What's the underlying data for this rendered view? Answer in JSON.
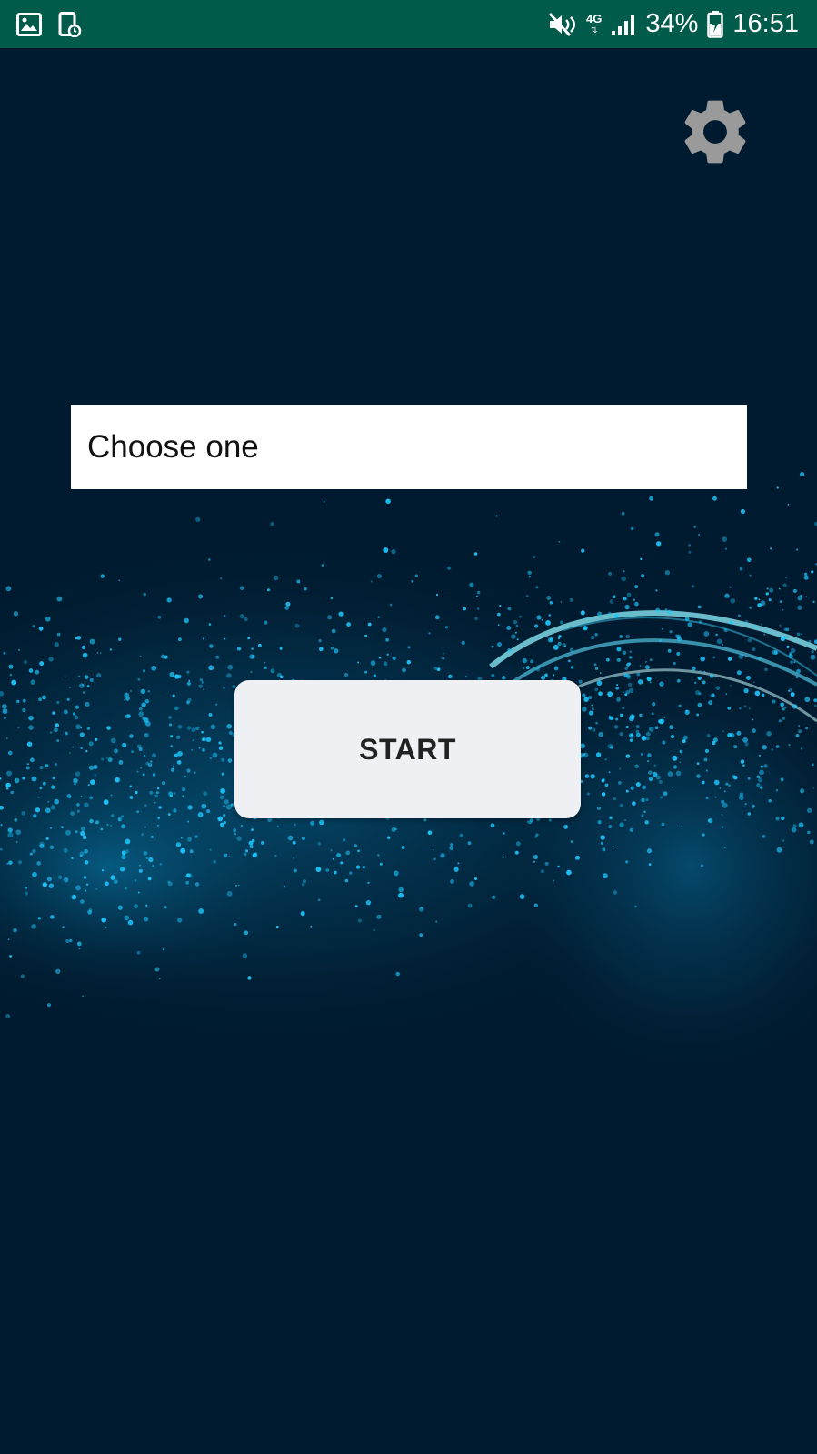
{
  "status_bar": {
    "signal_net": "4G",
    "battery": "34%",
    "time": "16:51",
    "icons": [
      "gallery-icon",
      "screenshot-icon",
      "mute-icon",
      "signal-icon",
      "battery-charging-icon"
    ]
  },
  "settings": {
    "icon": "gear-icon"
  },
  "spinner": {
    "text": "Choose one"
  },
  "start_button": {
    "label": "START"
  },
  "colors": {
    "status_bar": "#005b4a",
    "background": "#001b2f",
    "particles": "#1ec8ff",
    "button": "#eff0f3",
    "gear": "#9a9a9a"
  }
}
